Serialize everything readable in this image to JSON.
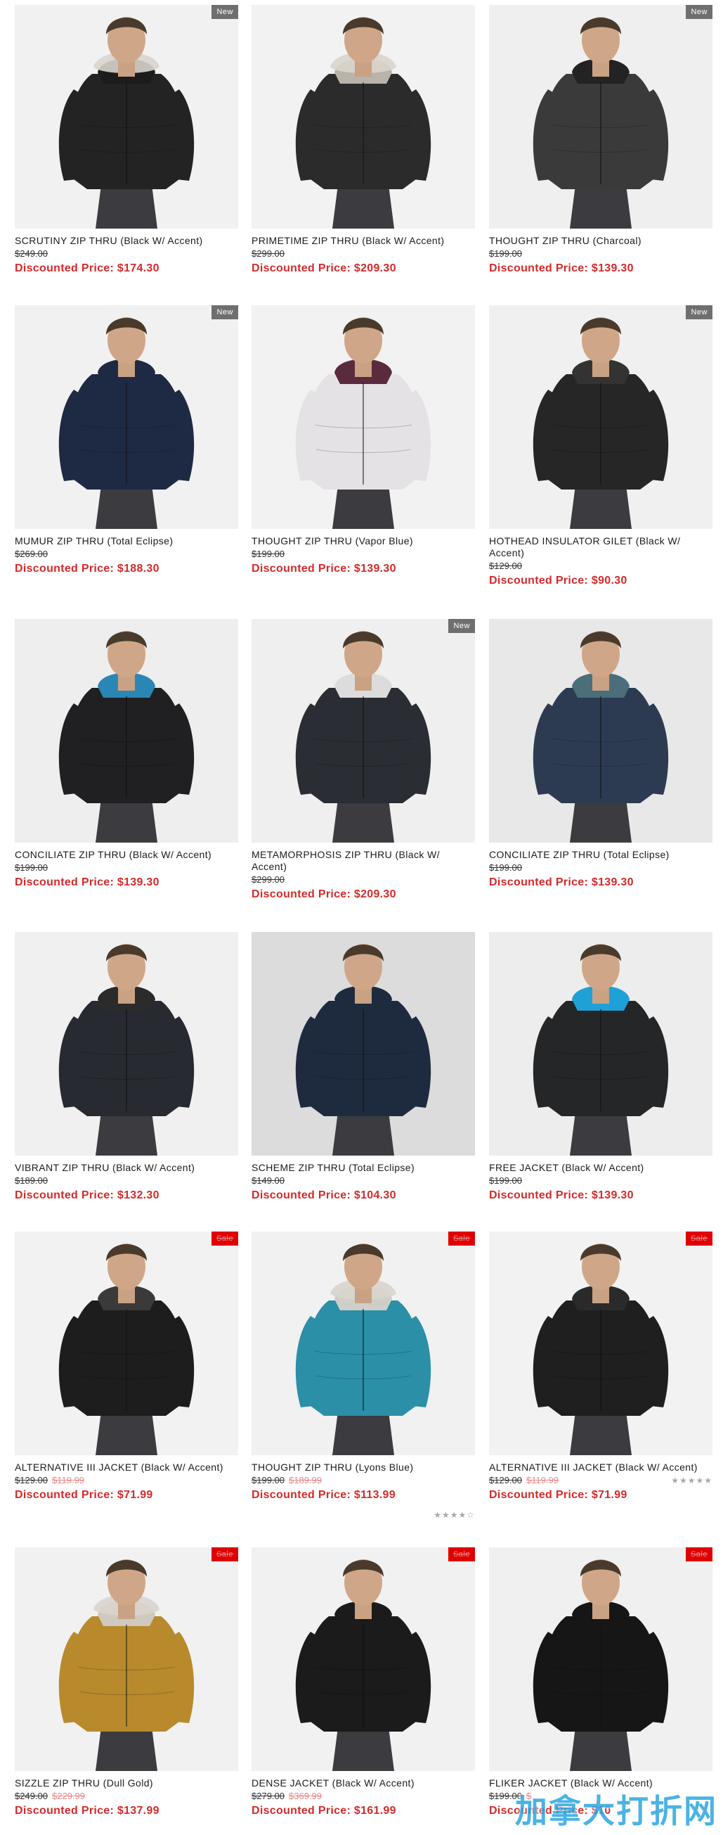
{
  "products": [
    {
      "name": "SCRUTINY ZIP THRU (Black W/ Accent)",
      "old_price": "$249.00",
      "sale_price": "",
      "discounted": "Discounted Price: $174.30",
      "badge": "New",
      "color": "#232323",
      "hood": "#1c1c1c",
      "fur": true,
      "bg": "#f1f1f1"
    },
    {
      "name": "PRIMETIME ZIP THRU (Black W/ Accent)",
      "old_price": "$299.00",
      "sale_price": "",
      "discounted": "Discounted Price: $209.30",
      "badge": "",
      "color": "#2b2b2b",
      "hood": "#b9b3aa",
      "fur": true,
      "bg": "#f2f2f2"
    },
    {
      "name": "THOUGHT ZIP THRU (Charcoal)",
      "old_price": "$199.00",
      "sale_price": "",
      "discounted": "Discounted Price: $139.30",
      "badge": "New",
      "color": "#3a3a3a",
      "hood": "#232323",
      "fur": false,
      "bg": "#efefef"
    },
    {
      "name": "MUMUR ZIP THRU (Total Eclipse)",
      "old_price": "$269.00",
      "sale_price": "",
      "discounted": "Discounted Price: $188.30",
      "badge": "New",
      "color": "#1e2a44",
      "hood": "#1e2a44",
      "fur": false,
      "bg": "#f1f1f1"
    },
    {
      "name": "THOUGHT ZIP THRU (Vapor Blue)",
      "old_price": "$199.00",
      "sale_price": "",
      "discounted": "Discounted Price: $139.30",
      "badge": "",
      "color": "#e4e2e4",
      "hood": "#5a2b3c",
      "fur": false,
      "bg": "#f2f2f2"
    },
    {
      "name": "HOTHEAD INSULATOR GILET (Black W/ Accent)",
      "old_price": "$129.00",
      "sale_price": "",
      "discounted": "Discounted Price: $90.30",
      "badge": "New",
      "color": "#262626",
      "hood": "#333333",
      "fur": false,
      "bg": "#f0f0f0"
    },
    {
      "name": "CONCILIATE ZIP THRU (Black W/ Accent)",
      "old_price": "$199.00",
      "sale_price": "",
      "discounted": "Discounted Price: $139.30",
      "badge": "",
      "color": "#202022",
      "hood": "#2a87b5",
      "fur": false,
      "bg": "#eeeeee"
    },
    {
      "name": "METAMORPHOSIS ZIP THRU (Black W/ Accent)",
      "old_price": "$299.00",
      "sale_price": "",
      "discounted": "Discounted Price: $209.30",
      "badge": "New",
      "color": "#2a2d33",
      "hood": "#dcdcdc",
      "fur": false,
      "bg": "#efefef"
    },
    {
      "name": "CONCILIATE ZIP THRU (Total Eclipse)",
      "old_price": "$199.00",
      "sale_price": "",
      "discounted": "Discounted Price: $139.30",
      "badge": "",
      "color": "#2d3b52",
      "hood": "#4a6e7a",
      "fur": false,
      "bg": "#e8e8e8"
    },
    {
      "name": "VIBRANT ZIP THRU (Black W/ Accent)",
      "old_price": "$189.00",
      "sale_price": "",
      "discounted": "Discounted Price: $132.30",
      "badge": "",
      "color": "#272a30",
      "hood": "#2b2b2b",
      "fur": false,
      "bg": "#f0f0f0"
    },
    {
      "name": "SCHEME ZIP THRU (Total Eclipse)",
      "old_price": "$149.00",
      "sale_price": "",
      "discounted": "Discounted Price: $104.30",
      "badge": "",
      "color": "#1e2b3f",
      "hood": "#1e2b3f",
      "fur": false,
      "bg": "#dcdcdc"
    },
    {
      "name": "FREE JACKET (Black W/ Accent)",
      "old_price": "$199.00",
      "sale_price": "",
      "discounted": "Discounted Price: $139.30",
      "badge": "",
      "color": "#252628",
      "hood": "#1fa0d6",
      "fur": false,
      "bg": "#ededed"
    },
    {
      "name": "ALTERNATIVE III JACKET (Black W/ Accent)",
      "old_price": "$129.00",
      "sale_price": "$119.99",
      "discounted": "Discounted Price: $71.99",
      "badge": "Sale",
      "color": "#1d1d1d",
      "hood": "#3a3a3a",
      "fur": false,
      "bg": "#f2f2f2"
    },
    {
      "name": "THOUGHT ZIP THRU (Lyons Blue)",
      "old_price": "$199.00",
      "sale_price": "$189.99",
      "discounted": "Discounted Price: $113.99",
      "badge": "Sale",
      "color": "#2b8fa8",
      "hood": "#cfcfc9",
      "fur": true,
      "bg": "#f1f1f1"
    },
    {
      "name": "ALTERNATIVE III JACKET (Black W/ Accent)",
      "old_price": "$129.00",
      "sale_price": "$119.99",
      "discounted": "Discounted Price: $71.99",
      "badge": "Sale",
      "color": "#1f1f1f",
      "hood": "#2a2a2a",
      "fur": false,
      "bg": "#f2f2f2"
    },
    {
      "name": "SIZZLE ZIP THRU (Dull Gold)",
      "old_price": "$249.00",
      "sale_price": "$229.99",
      "discounted": "Discounted Price: $137.99",
      "badge": "Sale",
      "color": "#b88a2c",
      "hood": "#cfc9bf",
      "fur": true,
      "bg": "#f1f1f1"
    },
    {
      "name": "DENSE JACKET (Black W/ Accent)",
      "old_price": "$279.00",
      "sale_price": "$369.99",
      "discounted": "Discounted Price: $161.99",
      "badge": "Sale",
      "color": "#1b1b1b",
      "hood": "#1b1b1b",
      "fur": false,
      "bg": "#f1f1f1"
    },
    {
      "name": "FLIKER JACKET (Black W/ Accent)",
      "old_price": "$199.00",
      "sale_price": "$",
      "discounted": "Discounted Price: $10",
      "badge": "Sale",
      "color": "#161616",
      "hood": "#161616",
      "fur": false,
      "bg": "#f0f0f0"
    }
  ],
  "ratings": {
    "first": "★★★★☆",
    "second": "★★★★★"
  },
  "watermark": "加拿大打折网"
}
